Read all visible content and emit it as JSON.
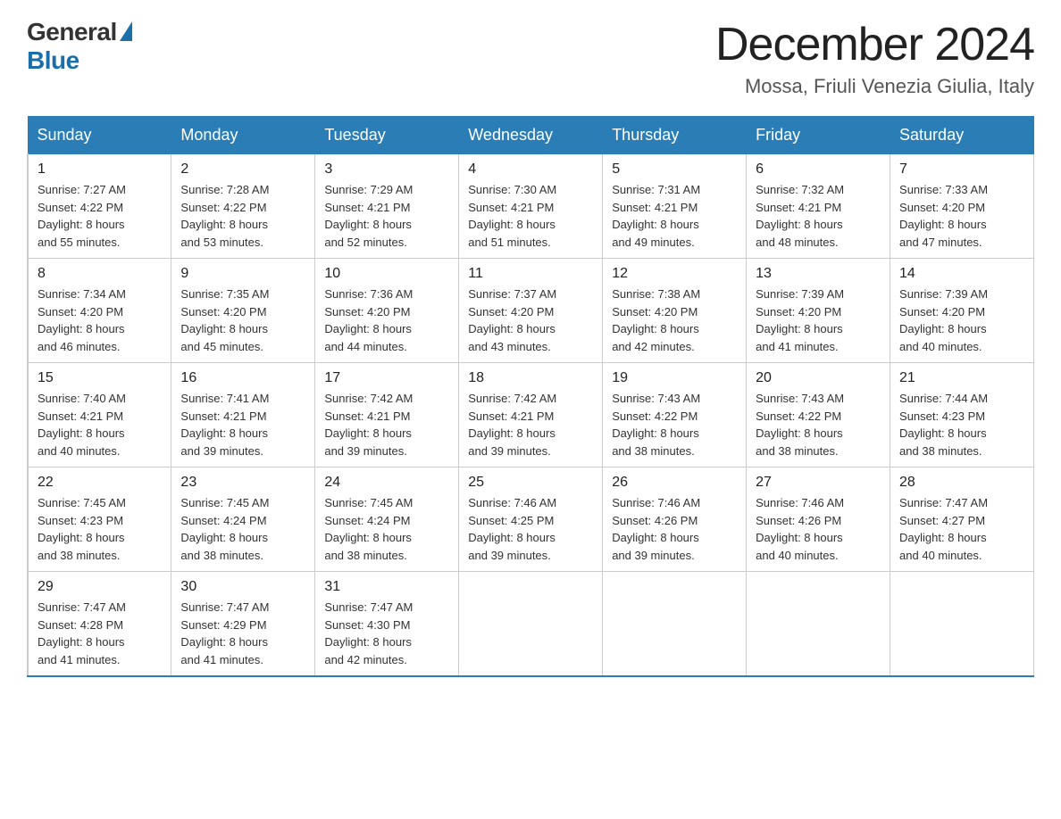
{
  "header": {
    "logo_general": "General",
    "logo_blue": "Blue",
    "title": "December 2024",
    "subtitle": "Mossa, Friuli Venezia Giulia, Italy"
  },
  "days_of_week": [
    "Sunday",
    "Monday",
    "Tuesday",
    "Wednesday",
    "Thursday",
    "Friday",
    "Saturday"
  ],
  "weeks": [
    [
      {
        "day": "1",
        "sunrise": "Sunrise: 7:27 AM",
        "sunset": "Sunset: 4:22 PM",
        "daylight": "Daylight: 8 hours",
        "daylight2": "and 55 minutes."
      },
      {
        "day": "2",
        "sunrise": "Sunrise: 7:28 AM",
        "sunset": "Sunset: 4:22 PM",
        "daylight": "Daylight: 8 hours",
        "daylight2": "and 53 minutes."
      },
      {
        "day": "3",
        "sunrise": "Sunrise: 7:29 AM",
        "sunset": "Sunset: 4:21 PM",
        "daylight": "Daylight: 8 hours",
        "daylight2": "and 52 minutes."
      },
      {
        "day": "4",
        "sunrise": "Sunrise: 7:30 AM",
        "sunset": "Sunset: 4:21 PM",
        "daylight": "Daylight: 8 hours",
        "daylight2": "and 51 minutes."
      },
      {
        "day": "5",
        "sunrise": "Sunrise: 7:31 AM",
        "sunset": "Sunset: 4:21 PM",
        "daylight": "Daylight: 8 hours",
        "daylight2": "and 49 minutes."
      },
      {
        "day": "6",
        "sunrise": "Sunrise: 7:32 AM",
        "sunset": "Sunset: 4:21 PM",
        "daylight": "Daylight: 8 hours",
        "daylight2": "and 48 minutes."
      },
      {
        "day": "7",
        "sunrise": "Sunrise: 7:33 AM",
        "sunset": "Sunset: 4:20 PM",
        "daylight": "Daylight: 8 hours",
        "daylight2": "and 47 minutes."
      }
    ],
    [
      {
        "day": "8",
        "sunrise": "Sunrise: 7:34 AM",
        "sunset": "Sunset: 4:20 PM",
        "daylight": "Daylight: 8 hours",
        "daylight2": "and 46 minutes."
      },
      {
        "day": "9",
        "sunrise": "Sunrise: 7:35 AM",
        "sunset": "Sunset: 4:20 PM",
        "daylight": "Daylight: 8 hours",
        "daylight2": "and 45 minutes."
      },
      {
        "day": "10",
        "sunrise": "Sunrise: 7:36 AM",
        "sunset": "Sunset: 4:20 PM",
        "daylight": "Daylight: 8 hours",
        "daylight2": "and 44 minutes."
      },
      {
        "day": "11",
        "sunrise": "Sunrise: 7:37 AM",
        "sunset": "Sunset: 4:20 PM",
        "daylight": "Daylight: 8 hours",
        "daylight2": "and 43 minutes."
      },
      {
        "day": "12",
        "sunrise": "Sunrise: 7:38 AM",
        "sunset": "Sunset: 4:20 PM",
        "daylight": "Daylight: 8 hours",
        "daylight2": "and 42 minutes."
      },
      {
        "day": "13",
        "sunrise": "Sunrise: 7:39 AM",
        "sunset": "Sunset: 4:20 PM",
        "daylight": "Daylight: 8 hours",
        "daylight2": "and 41 minutes."
      },
      {
        "day": "14",
        "sunrise": "Sunrise: 7:39 AM",
        "sunset": "Sunset: 4:20 PM",
        "daylight": "Daylight: 8 hours",
        "daylight2": "and 40 minutes."
      }
    ],
    [
      {
        "day": "15",
        "sunrise": "Sunrise: 7:40 AM",
        "sunset": "Sunset: 4:21 PM",
        "daylight": "Daylight: 8 hours",
        "daylight2": "and 40 minutes."
      },
      {
        "day": "16",
        "sunrise": "Sunrise: 7:41 AM",
        "sunset": "Sunset: 4:21 PM",
        "daylight": "Daylight: 8 hours",
        "daylight2": "and 39 minutes."
      },
      {
        "day": "17",
        "sunrise": "Sunrise: 7:42 AM",
        "sunset": "Sunset: 4:21 PM",
        "daylight": "Daylight: 8 hours",
        "daylight2": "and 39 minutes."
      },
      {
        "day": "18",
        "sunrise": "Sunrise: 7:42 AM",
        "sunset": "Sunset: 4:21 PM",
        "daylight": "Daylight: 8 hours",
        "daylight2": "and 39 minutes."
      },
      {
        "day": "19",
        "sunrise": "Sunrise: 7:43 AM",
        "sunset": "Sunset: 4:22 PM",
        "daylight": "Daylight: 8 hours",
        "daylight2": "and 38 minutes."
      },
      {
        "day": "20",
        "sunrise": "Sunrise: 7:43 AM",
        "sunset": "Sunset: 4:22 PM",
        "daylight": "Daylight: 8 hours",
        "daylight2": "and 38 minutes."
      },
      {
        "day": "21",
        "sunrise": "Sunrise: 7:44 AM",
        "sunset": "Sunset: 4:23 PM",
        "daylight": "Daylight: 8 hours",
        "daylight2": "and 38 minutes."
      }
    ],
    [
      {
        "day": "22",
        "sunrise": "Sunrise: 7:45 AM",
        "sunset": "Sunset: 4:23 PM",
        "daylight": "Daylight: 8 hours",
        "daylight2": "and 38 minutes."
      },
      {
        "day": "23",
        "sunrise": "Sunrise: 7:45 AM",
        "sunset": "Sunset: 4:24 PM",
        "daylight": "Daylight: 8 hours",
        "daylight2": "and 38 minutes."
      },
      {
        "day": "24",
        "sunrise": "Sunrise: 7:45 AM",
        "sunset": "Sunset: 4:24 PM",
        "daylight": "Daylight: 8 hours",
        "daylight2": "and 38 minutes."
      },
      {
        "day": "25",
        "sunrise": "Sunrise: 7:46 AM",
        "sunset": "Sunset: 4:25 PM",
        "daylight": "Daylight: 8 hours",
        "daylight2": "and 39 minutes."
      },
      {
        "day": "26",
        "sunrise": "Sunrise: 7:46 AM",
        "sunset": "Sunset: 4:26 PM",
        "daylight": "Daylight: 8 hours",
        "daylight2": "and 39 minutes."
      },
      {
        "day": "27",
        "sunrise": "Sunrise: 7:46 AM",
        "sunset": "Sunset: 4:26 PM",
        "daylight": "Daylight: 8 hours",
        "daylight2": "and 40 minutes."
      },
      {
        "day": "28",
        "sunrise": "Sunrise: 7:47 AM",
        "sunset": "Sunset: 4:27 PM",
        "daylight": "Daylight: 8 hours",
        "daylight2": "and 40 minutes."
      }
    ],
    [
      {
        "day": "29",
        "sunrise": "Sunrise: 7:47 AM",
        "sunset": "Sunset: 4:28 PM",
        "daylight": "Daylight: 8 hours",
        "daylight2": "and 41 minutes."
      },
      {
        "day": "30",
        "sunrise": "Sunrise: 7:47 AM",
        "sunset": "Sunset: 4:29 PM",
        "daylight": "Daylight: 8 hours",
        "daylight2": "and 41 minutes."
      },
      {
        "day": "31",
        "sunrise": "Sunrise: 7:47 AM",
        "sunset": "Sunset: 4:30 PM",
        "daylight": "Daylight: 8 hours",
        "daylight2": "and 42 minutes."
      },
      null,
      null,
      null,
      null
    ]
  ]
}
